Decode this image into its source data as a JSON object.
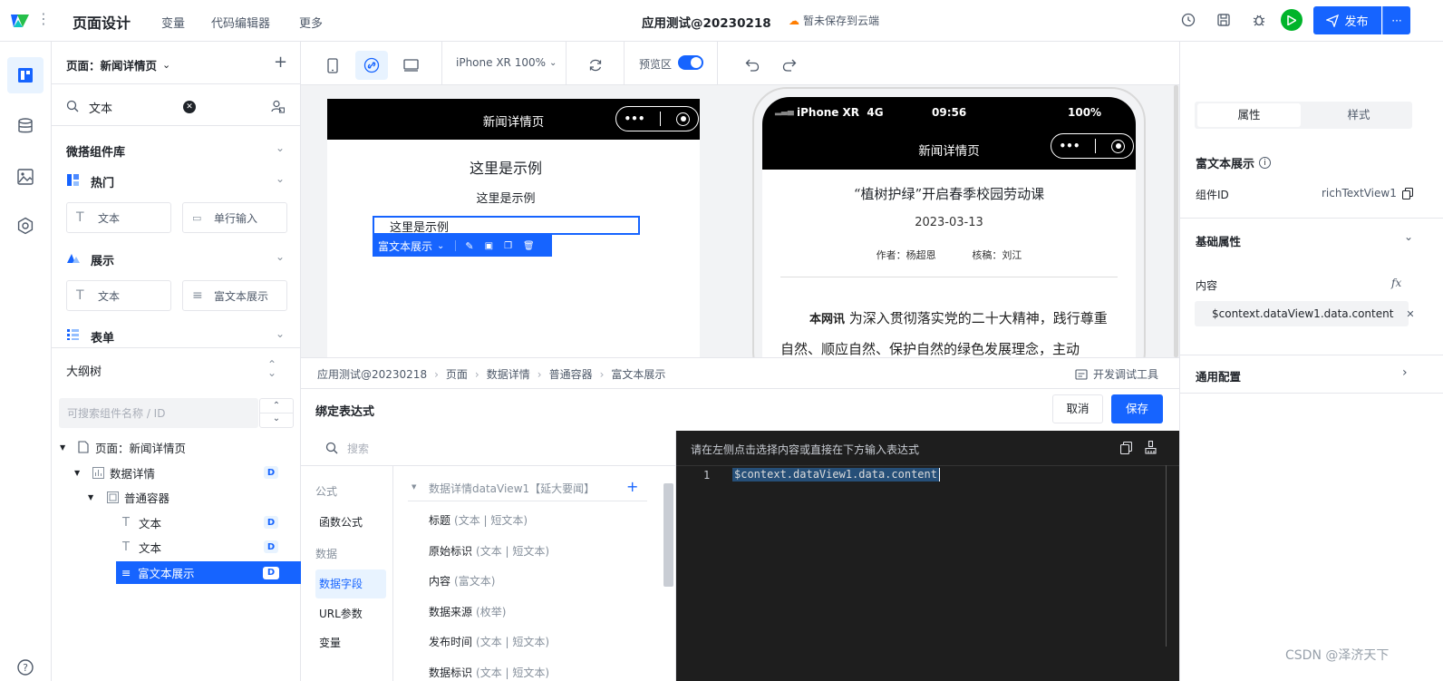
{
  "header": {
    "page_design": "页面设计",
    "nav": [
      "变量",
      "代码编辑器",
      "更多"
    ],
    "app_title": "应用测试@20230218",
    "cloud_status": "暂未保存到云端",
    "publish": "发布",
    "more": "···"
  },
  "left_panel": {
    "page_selector": "页面：新闻详情页",
    "search_value": "文本",
    "library_title": "微搭组件库",
    "sections": [
      {
        "label": "热门",
        "items": [
          "文本",
          "单行输入"
        ]
      },
      {
        "label": "展示",
        "items": [
          "文本",
          "富文本展示"
        ]
      },
      {
        "label": "表单",
        "items": []
      }
    ],
    "outline_title": "大纲树",
    "outline_search_placeholder": "可搜索组件名称 / ID",
    "tree": [
      {
        "label": "页面：新闻详情页",
        "badge": ""
      },
      {
        "label": "数据详情",
        "badge": "D"
      },
      {
        "label": "普通容器",
        "badge": ""
      },
      {
        "label": "文本",
        "badge": "D"
      },
      {
        "label": "文本",
        "badge": "D"
      },
      {
        "label": "富文本展示",
        "badge": "D"
      }
    ]
  },
  "toolbar": {
    "device": "iPhone XR 100%",
    "preview_label": "预览区",
    "preview_on": true
  },
  "canvas": {
    "page_title": "新闻详情页",
    "text1": "这里是示例",
    "text2": "这里是示例",
    "text3": "这里是示例",
    "selection_label": "富文本展示"
  },
  "phone": {
    "carrier": "iPhone XR  4G",
    "time": "09:56",
    "battery": "100%",
    "title": "新闻详情页",
    "headline": "“植树护绿”开启春季校园劳动课",
    "date": "2023-03-13",
    "byline": "作者：杨超恩      核稿：刘江",
    "body_lead": "本网讯",
    "body_text": " 为深入贯彻落实党的二十大精神，践行尊重自然、顺应自然、保护自然的绿色发展理念，主动"
  },
  "breadcrumb": [
    "应用测试@20230218",
    "页面",
    "数据详情",
    "普通容器",
    "富文本展示"
  ],
  "dev_tools": "开发调试工具",
  "binding": {
    "title": "绑定表达式",
    "cancel": "取消",
    "save": "保存",
    "search_placeholder": "搜索",
    "categories": [
      {
        "label": "公式",
        "type": "group"
      },
      {
        "label": "函数公式",
        "type": "item"
      },
      {
        "label": "数据",
        "type": "group"
      },
      {
        "label": "数据字段",
        "type": "active"
      },
      {
        "label": "URL参数",
        "type": "item"
      },
      {
        "label": "变量",
        "type": "item"
      }
    ],
    "datasource": "数据详情dataView1【延大要闻】",
    "fields": [
      {
        "name": "标题",
        "type": "(文本 | 短文本)"
      },
      {
        "name": "原始标识",
        "type": "(文本 | 短文本)"
      },
      {
        "name": "内容",
        "type": "(富文本)"
      },
      {
        "name": "数据来源",
        "type": "(枚举)"
      },
      {
        "name": "发布时间",
        "type": "(文本 | 短文本)"
      },
      {
        "name": "数据标识",
        "type": "(文本 | 短文本)"
      }
    ],
    "editor_hint": "请在左侧点击选择内容或直接在下方输入表达式",
    "line_number": "1",
    "expression": "$context.dataView1.data.content"
  },
  "right_panel": {
    "tabs": [
      "属性",
      "样式"
    ],
    "component_name": "富文本展示",
    "component_id_label": "组件ID",
    "component_id": "richTextView1",
    "basic_props": "基础属性",
    "content_label": "内容",
    "fx": "fx",
    "content_value": "$context.dataView1.data.content",
    "general_config": "通用配置"
  },
  "watermark": "CSDN @泽济天下",
  "colors": {
    "accent": "#1664ff",
    "green": "#00b42a",
    "editor_bg": "#1e1e1e"
  }
}
